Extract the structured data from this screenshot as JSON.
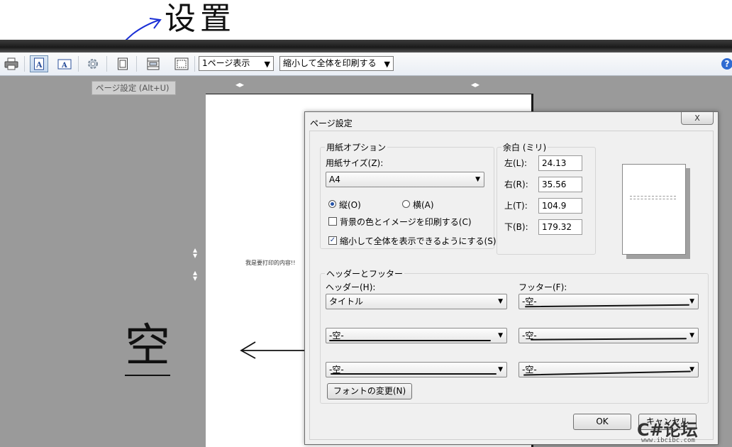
{
  "annotations": {
    "settings_note": "设置",
    "empty_note": "空"
  },
  "toolbar": {
    "page_view_select": "1ページ表示",
    "print_scale_select": "縮小して全体を印刷する",
    "help": "?"
  },
  "tooltip": "ページ設定 (Alt+U)",
  "page_preview": {
    "content_text": "我是要打印的内容!!"
  },
  "dialog": {
    "title": "ページ設定",
    "close": "X",
    "paper": {
      "legend": "用紙オプション",
      "size_label": "用紙サイズ(Z):",
      "size_value": "A4",
      "portrait": "縦(O)",
      "landscape": "横(A)",
      "orientation_selected": "portrait",
      "print_background": "背景の色とイメージを印刷する(C)",
      "print_background_checked": false,
      "shrink_to_fit": "縮小して全体を表示できるようにする(S)",
      "shrink_to_fit_checked": true
    },
    "margins": {
      "legend": "余白 (ミリ)",
      "left_label": "左(L):",
      "left_value": "24.13",
      "right_label": "右(R):",
      "right_value": "35.56",
      "top_label": "上(T):",
      "top_value": "104.9",
      "bottom_label": "下(B):",
      "bottom_value": "179.32"
    },
    "header_footer": {
      "legend": "ヘッダーとフッター",
      "header_label": "ヘッダー(H):",
      "footer_label": "フッター(F):",
      "header_1": "タイトル",
      "header_2": "-空-",
      "header_3": "-空-",
      "footer_1": "-空-",
      "footer_2": "-空-",
      "footer_3": "-空-",
      "font_button": "フォントの変更(N)"
    },
    "ok": "OK",
    "cancel": "キャンセル"
  },
  "watermark": {
    "brand": "C#论坛",
    "url": "www.ibcibc.com"
  }
}
